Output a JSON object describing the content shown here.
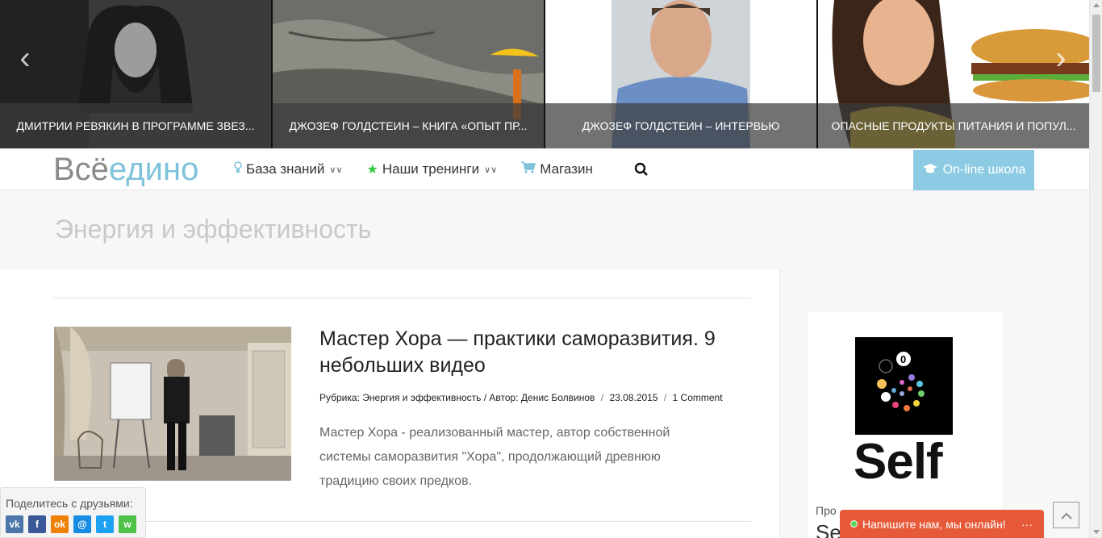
{
  "slider": {
    "prev_icon": "chevron-left-icon",
    "next_icon": "chevron-right-icon",
    "slides": [
      {
        "caption": "ДМИТРИИ РЕВЯКИН В ПРОГРАММЕ ЗВЕЗ..."
      },
      {
        "caption": "ДЖОЗЕФ ГОЛДСТЕИН – КНИГА «ОПЫТ ПР..."
      },
      {
        "caption": "ДЖОЗЕФ ГОЛДСТЕИН – ИНТЕРВЬЮ"
      },
      {
        "caption": "ОПАСНЫЕ ПРОДУКТЫ ПИТАНИЯ И ПОПУЛ..."
      }
    ]
  },
  "header": {
    "logo_part1": "Всё",
    "logo_part2": "едино",
    "nav": [
      {
        "label": "База знаний",
        "icon": "lightbulb-icon"
      },
      {
        "label": "Наши тренинги",
        "icon": "star-icon"
      },
      {
        "label": "Магазин",
        "icon": "cart-icon"
      }
    ],
    "search_icon": "search-icon",
    "school_label": "On-line школа",
    "school_icon": "graduation-cap-icon",
    "colors": {
      "accent": "#8ccbe3",
      "logo_blue": "#7fc2dc",
      "logo_grey": "#8a8a8a",
      "star": "#2ecc40"
    }
  },
  "page": {
    "title": "Энергия и эффективность"
  },
  "post": {
    "title": "Мастер Хора — практики саморазвития. 9 небольших видео",
    "rubric_label": "Рубрика:",
    "rubric_value": "Энергия и эффективность",
    "author_label": "Автор:",
    "author_value": "Денис Болвинов",
    "date": "23.08.2015",
    "comments": "1 Comment",
    "excerpt": "Мастер Хора - реализованный мастер, автор собственной системы саморазвития \"Хора\", продолжающий древнюю традицию своих предков."
  },
  "sidebar": {
    "ad_word": "Self",
    "ad_digit": "0",
    "text_partial": "Про",
    "text_partial2": "Se"
  },
  "share": {
    "label": "Поделитесь с друзьями:",
    "buttons": [
      {
        "name": "vk",
        "glyph": "vk",
        "color": "#4a76a8"
      },
      {
        "name": "facebook",
        "glyph": "f",
        "color": "#3b5998"
      },
      {
        "name": "odnoklassniki",
        "glyph": "ok",
        "color": "#ee8208"
      },
      {
        "name": "moimir",
        "glyph": "@",
        "color": "#168de2"
      },
      {
        "name": "twitter",
        "glyph": "t",
        "color": "#1da1f2"
      },
      {
        "name": "whatsapp",
        "glyph": "w",
        "color": "#4dc247"
      }
    ]
  },
  "chat": {
    "label": "Напишите нам, мы онлайн!",
    "more": "···",
    "color": "#e65a3a"
  },
  "to_top_icon": "arrow-up-icon"
}
